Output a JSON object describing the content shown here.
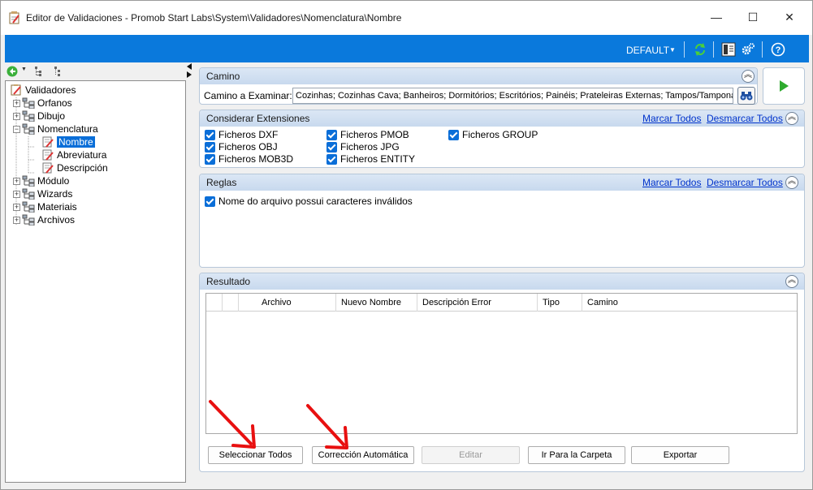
{
  "window": {
    "title": "Editor de Validaciones - Promob Start Labs\\System\\Validadores\\Nomenclatura\\Nombre",
    "controls": {
      "minimize": "—",
      "maximize": "☐",
      "close": "✕"
    }
  },
  "toolbar": {
    "profile_label": "DEFAULT",
    "icons": [
      "refresh-icon",
      "panel-layout-icon",
      "settings-icon",
      "help-icon"
    ]
  },
  "tree": {
    "items": [
      {
        "label": "Validadores"
      },
      {
        "label": "Orfanos"
      },
      {
        "label": "Dibujo"
      },
      {
        "label": "Nomenclatura"
      },
      {
        "label": "Nombre"
      },
      {
        "label": "Abreviatura"
      },
      {
        "label": "Descripción"
      },
      {
        "label": "Módulo"
      },
      {
        "label": "Wizards"
      },
      {
        "label": "Materiais"
      },
      {
        "label": "Archivos"
      }
    ]
  },
  "camino": {
    "title": "Camino",
    "label": "Camino a Examinar:",
    "value": "Cozinhas; Cozinhas Cava; Banheiros; Dormitórios; Escritórios; Painéis; Prateleiras Externas; Tampos/Tamponamentos"
  },
  "extensiones": {
    "title": "Considerar Extensiones",
    "mark_all": "Marcar Todos",
    "unmark_all": "Desmarcar Todos",
    "items": [
      "Ficheros DXF",
      "Ficheros OBJ",
      "Ficheros MOB3D",
      "Ficheros PMOB",
      "Ficheros JPG",
      "Ficheros ENTITY",
      "Ficheros GROUP"
    ]
  },
  "reglas": {
    "title": "Reglas",
    "mark_all": "Marcar Todos",
    "unmark_all": "Desmarcar Todos",
    "items": [
      "Nome do arquivo possui caracteres inválidos"
    ]
  },
  "resultado": {
    "title": "Resultado",
    "columns": [
      "Archivo",
      "Nuevo Nombre",
      "Descripción Error",
      "Tipo",
      "Camino"
    ],
    "buttons": {
      "select_all": "Seleccionar Todos",
      "auto_fix": "Corrección Automática",
      "edit": "Editar",
      "open_folder": "Ir Para la Carpeta",
      "export": "Exportar"
    }
  },
  "colors": {
    "accent": "#0a79dc",
    "annotation_arrow": "#e81010"
  }
}
